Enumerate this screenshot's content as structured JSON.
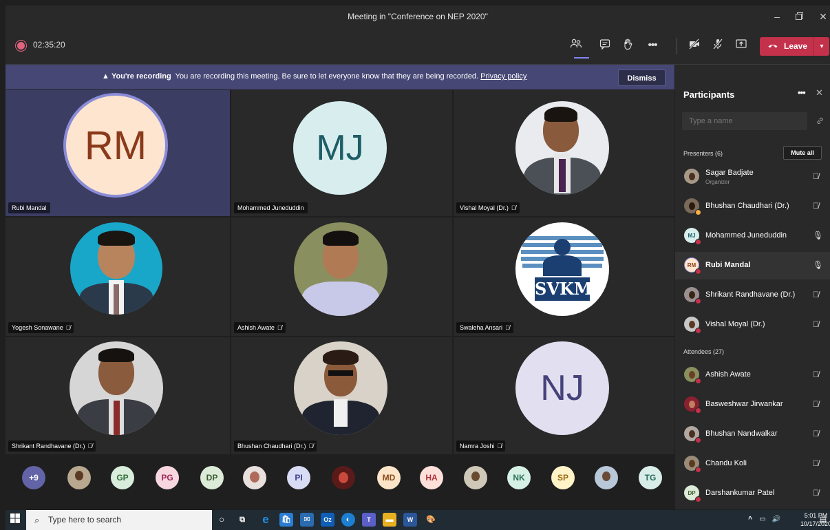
{
  "window": {
    "title": "Meeting in \"Conference on NEP 2020\""
  },
  "toolbar": {
    "timer": "02:35:20",
    "leave_label": "Leave"
  },
  "banner": {
    "heading": "You're recording",
    "message": "You are recording this meeting. Be sure to let everyone know that they are being recorded.",
    "link": "Privacy policy",
    "dismiss_label": "Dismiss"
  },
  "tiles": [
    {
      "name": "Rubi Mandal",
      "initials": "RM",
      "muted": false
    },
    {
      "name": "Mohammed Juneduddin",
      "initials": "MJ",
      "muted": false
    },
    {
      "name": "Vishal Moyal (Dr.)",
      "initials": "",
      "muted": true
    },
    {
      "name": "Yogesh Sonawane",
      "initials": "",
      "muted": true
    },
    {
      "name": "Ashish Awate",
      "initials": "",
      "muted": true
    },
    {
      "name": "Swaleha Ansari",
      "initials": "",
      "muted": true,
      "logo_text": "SVKM"
    },
    {
      "name": "Shrikant Randhavane (Dr.)",
      "initials": "",
      "muted": true
    },
    {
      "name": "Bhushan Chaudhari (Dr.)",
      "initials": "",
      "muted": true
    },
    {
      "name": "Namra Joshi",
      "initials": "NJ",
      "muted": true
    }
  ],
  "strip": [
    {
      "label": "+9"
    },
    {
      "label": ""
    },
    {
      "label": "GP"
    },
    {
      "label": "PG"
    },
    {
      "label": "DP"
    },
    {
      "label": ""
    },
    {
      "label": "PI"
    },
    {
      "label": ""
    },
    {
      "label": "MD"
    },
    {
      "label": "HA"
    },
    {
      "label": ""
    },
    {
      "label": "NK"
    },
    {
      "label": "SP"
    },
    {
      "label": ""
    },
    {
      "label": "TG"
    }
  ],
  "panel": {
    "title": "Participants",
    "search_placeholder": "Type a name",
    "presenters_header": "Presenters (6)",
    "mute_all_label": "Mute all",
    "attendees_header": "Attendees (27)",
    "presenters": [
      {
        "name": "Sagar Badjate",
        "sub": "Organizer",
        "initials": "",
        "mic": "muted"
      },
      {
        "name": "Bhushan Chaudhari (Dr.)",
        "sub": "",
        "initials": "",
        "mic": "muted"
      },
      {
        "name": "Mohammed Juneduddin",
        "sub": "",
        "initials": "MJ",
        "mic": "on"
      },
      {
        "name": "Rubi Mandal",
        "sub": "",
        "initials": "RM",
        "mic": "on"
      },
      {
        "name": "Shrikant Randhavane (Dr.)",
        "sub": "",
        "initials": "",
        "mic": "muted"
      },
      {
        "name": "Vishal Moyal (Dr.)",
        "sub": "",
        "initials": "",
        "mic": "muted"
      }
    ],
    "attendees": [
      {
        "name": "Ashish Awate",
        "initials": "",
        "mic": "muted"
      },
      {
        "name": "Basweshwar Jirwankar",
        "initials": "",
        "mic": "muted"
      },
      {
        "name": "Bhushan Nandwalkar",
        "initials": "",
        "mic": "muted"
      },
      {
        "name": "Chandu Koli",
        "initials": "",
        "mic": "muted"
      },
      {
        "name": "Darshankumar Patel",
        "initials": "DP",
        "mic": "muted"
      }
    ]
  },
  "taskbar": {
    "search_placeholder": "Type here to search",
    "time": "5:01 PM",
    "date": "10/17/2020"
  },
  "colors": {
    "accent": "#7f85f5",
    "leave": "#c4314b",
    "banner": "#464775"
  }
}
